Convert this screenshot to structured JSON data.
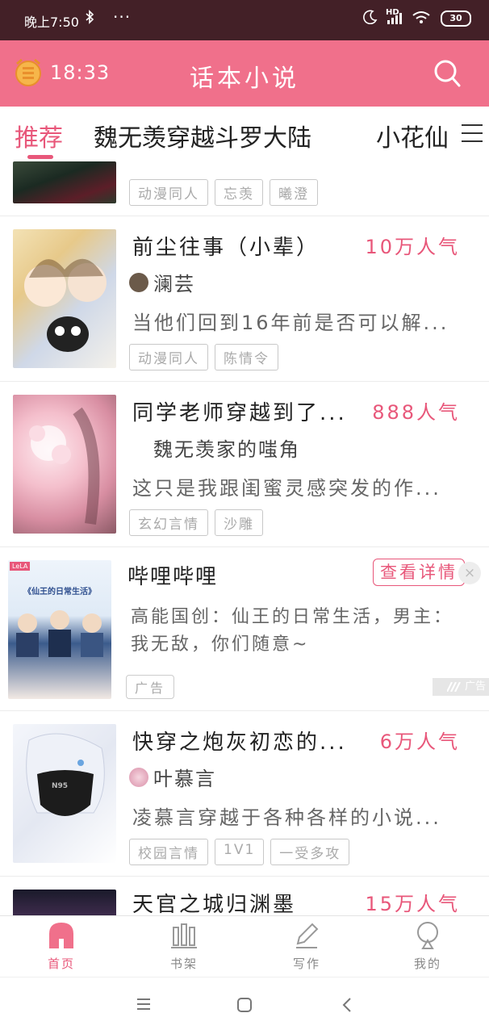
{
  "status_bar": {
    "time": "晚上7:50",
    "bluetooth_icon": "bluetooth-icon",
    "more": "···",
    "hd": "HD",
    "battery": "30"
  },
  "header": {
    "alarm_icon": "alarm-clock-icon",
    "time": "18:33",
    "title": "话本小说",
    "search_icon": "search-icon"
  },
  "tabs": {
    "items": [
      "推荐",
      "魏无羡穿越斗罗大陆",
      "小花仙"
    ],
    "active": "推荐",
    "menu_icon": "menu-icon"
  },
  "books": [
    {
      "tags": [
        "动漫同人",
        "忘羡",
        "曦澄"
      ]
    },
    {
      "title": "前尘往事（小辈）",
      "popularity": "10万人气",
      "author": "澜芸",
      "desc": "当他们回到16年前是否可以解...",
      "tags": [
        "动漫同人",
        "陈情令"
      ]
    },
    {
      "title": "同学老师穿越到了...",
      "popularity": "888人气",
      "author": "魏无羡家的嗤角",
      "desc": "这只是我跟闺蜜灵感突发的作...",
      "tags": [
        "玄幻言情",
        "沙雕"
      ]
    }
  ],
  "ad": {
    "title": "哔哩哔哩",
    "button": "查看详情",
    "close": "×",
    "cover_label": "《仙王的日常生活》",
    "cover_logo": "LeLA",
    "desc": "高能国创：仙王的日常生活，男主：我无敌，你们随意~",
    "tag": "广告",
    "mark": "广告"
  },
  "books2": [
    {
      "title": "快穿之炮灰初恋的...",
      "popularity": "6万人气",
      "author": "叶慕言",
      "desc": "凌慕言穿越于各种各样的小说...",
      "tags": [
        "校园言情",
        "1V1",
        "一受多攻"
      ],
      "cover_text": "N95"
    },
    {
      "title": "天官之城归渊墨",
      "popularity": "15万人气"
    }
  ],
  "bottom_nav": [
    {
      "label": "首页",
      "icon": "home-icon",
      "active": true
    },
    {
      "label": "书架",
      "icon": "bookshelf-icon",
      "active": false
    },
    {
      "label": "写作",
      "icon": "pen-icon",
      "active": false
    },
    {
      "label": "我的",
      "icon": "profile-icon",
      "active": false
    }
  ],
  "system_nav": {
    "menu": "menu-icon",
    "home": "home-square-icon",
    "back": "back-icon"
  },
  "colors": {
    "accent": "#f0708b",
    "status_bar": "#432027",
    "popularity": "#e8577a"
  }
}
